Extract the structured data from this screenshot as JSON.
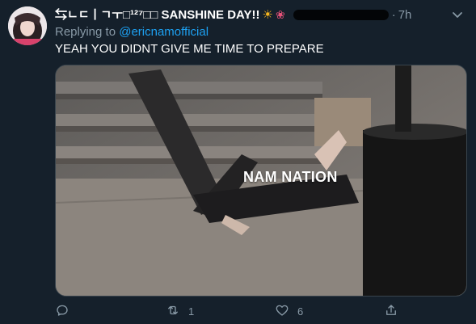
{
  "tweet": {
    "display_name": "⇆ㄴㄷㅣㄱㅜ□¹²⁷□□ SANSHINE DAY!!",
    "time_sep": "·",
    "time": "7h",
    "replying_prefix": "Replying to ",
    "replying_handle": "@ericnamofficial",
    "text": "YEAH YOU DIDNT GIVE ME TIME TO PREPARE",
    "media_caption": "NAM NATION"
  },
  "actions": {
    "reply_count": "",
    "retweet_count": "1",
    "like_count": "6"
  },
  "icons": [
    "sun-icon",
    "tulip-icon",
    "chevron-down-icon",
    "reply-icon",
    "retweet-icon",
    "like-icon",
    "share-icon"
  ],
  "colors": {
    "background": "#15202b",
    "link": "#1da1f2",
    "secondary_text": "#8899a6"
  }
}
